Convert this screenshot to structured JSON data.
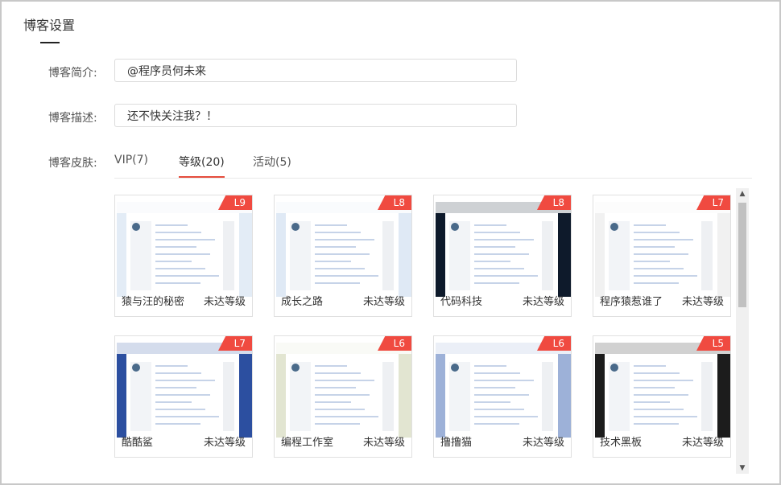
{
  "page": {
    "title": "博客设置"
  },
  "form": {
    "intro_label": "博客简介:",
    "intro_value": "@程序员何未来",
    "desc_label": "博客描述:",
    "desc_value": "还不快关注我？！",
    "skin_label": "博客皮肤:"
  },
  "tabs": [
    {
      "label": "VIP(7)"
    },
    {
      "label": "等级(20)",
      "active": true
    },
    {
      "label": "活动(5)"
    }
  ],
  "skins": [
    {
      "name": "猿与汪的秘密",
      "level": "L9",
      "status": "未达等级",
      "bg": "#e3ecf6"
    },
    {
      "name": "成长之路",
      "level": "L8",
      "status": "未达等级",
      "bg": "#dfe9f5"
    },
    {
      "name": "代码科技",
      "level": "L8",
      "status": "未达等级",
      "bg": "#0e1a2b"
    },
    {
      "name": "程序猿惹谁了",
      "level": "L7",
      "status": "未达等级",
      "bg": "#f1f1f1"
    },
    {
      "name": "酷酷鲨",
      "level": "L7",
      "status": "未达等级",
      "bg": "#2c4fa0"
    },
    {
      "name": "编程工作室",
      "level": "L6",
      "status": "未达等级",
      "bg": "#e2e5d1"
    },
    {
      "name": "撸撸猫",
      "level": "L6",
      "status": "未达等级",
      "bg": "#9db1d8"
    },
    {
      "name": "技术黑板",
      "level": "L5",
      "status": "未达等级",
      "bg": "#1c1c1c"
    }
  ],
  "colors": {
    "accent": "#e64d3d",
    "badge": "#f04a40"
  }
}
